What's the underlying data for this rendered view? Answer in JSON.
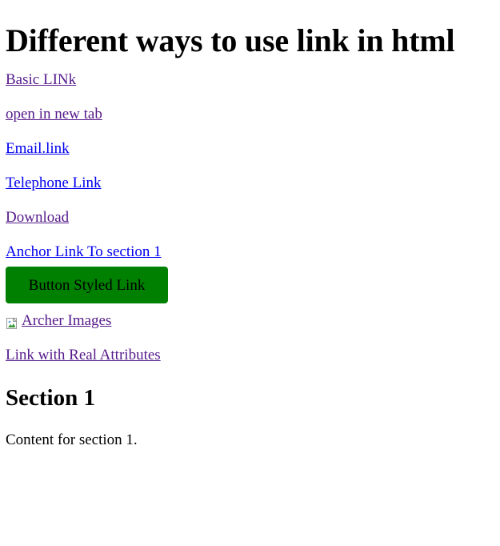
{
  "page": {
    "title": "Different ways to use link in html"
  },
  "links": {
    "basic": "Basic LINk",
    "new_tab": "open in new tab",
    "email": "Email.link",
    "telephone": "Telephone Link",
    "download": "Download",
    "anchor": "Anchor Link To section 1",
    "button": "Button Styled Link",
    "image_alt": "Archer Images",
    "real_attributes": "Link with Real Attributes"
  },
  "section1": {
    "heading": "Section 1",
    "content": "Content for section 1."
  },
  "colors": {
    "visited_link": "#551a8b",
    "unvisited_link": "#0000ee",
    "button_bg": "#008000"
  }
}
